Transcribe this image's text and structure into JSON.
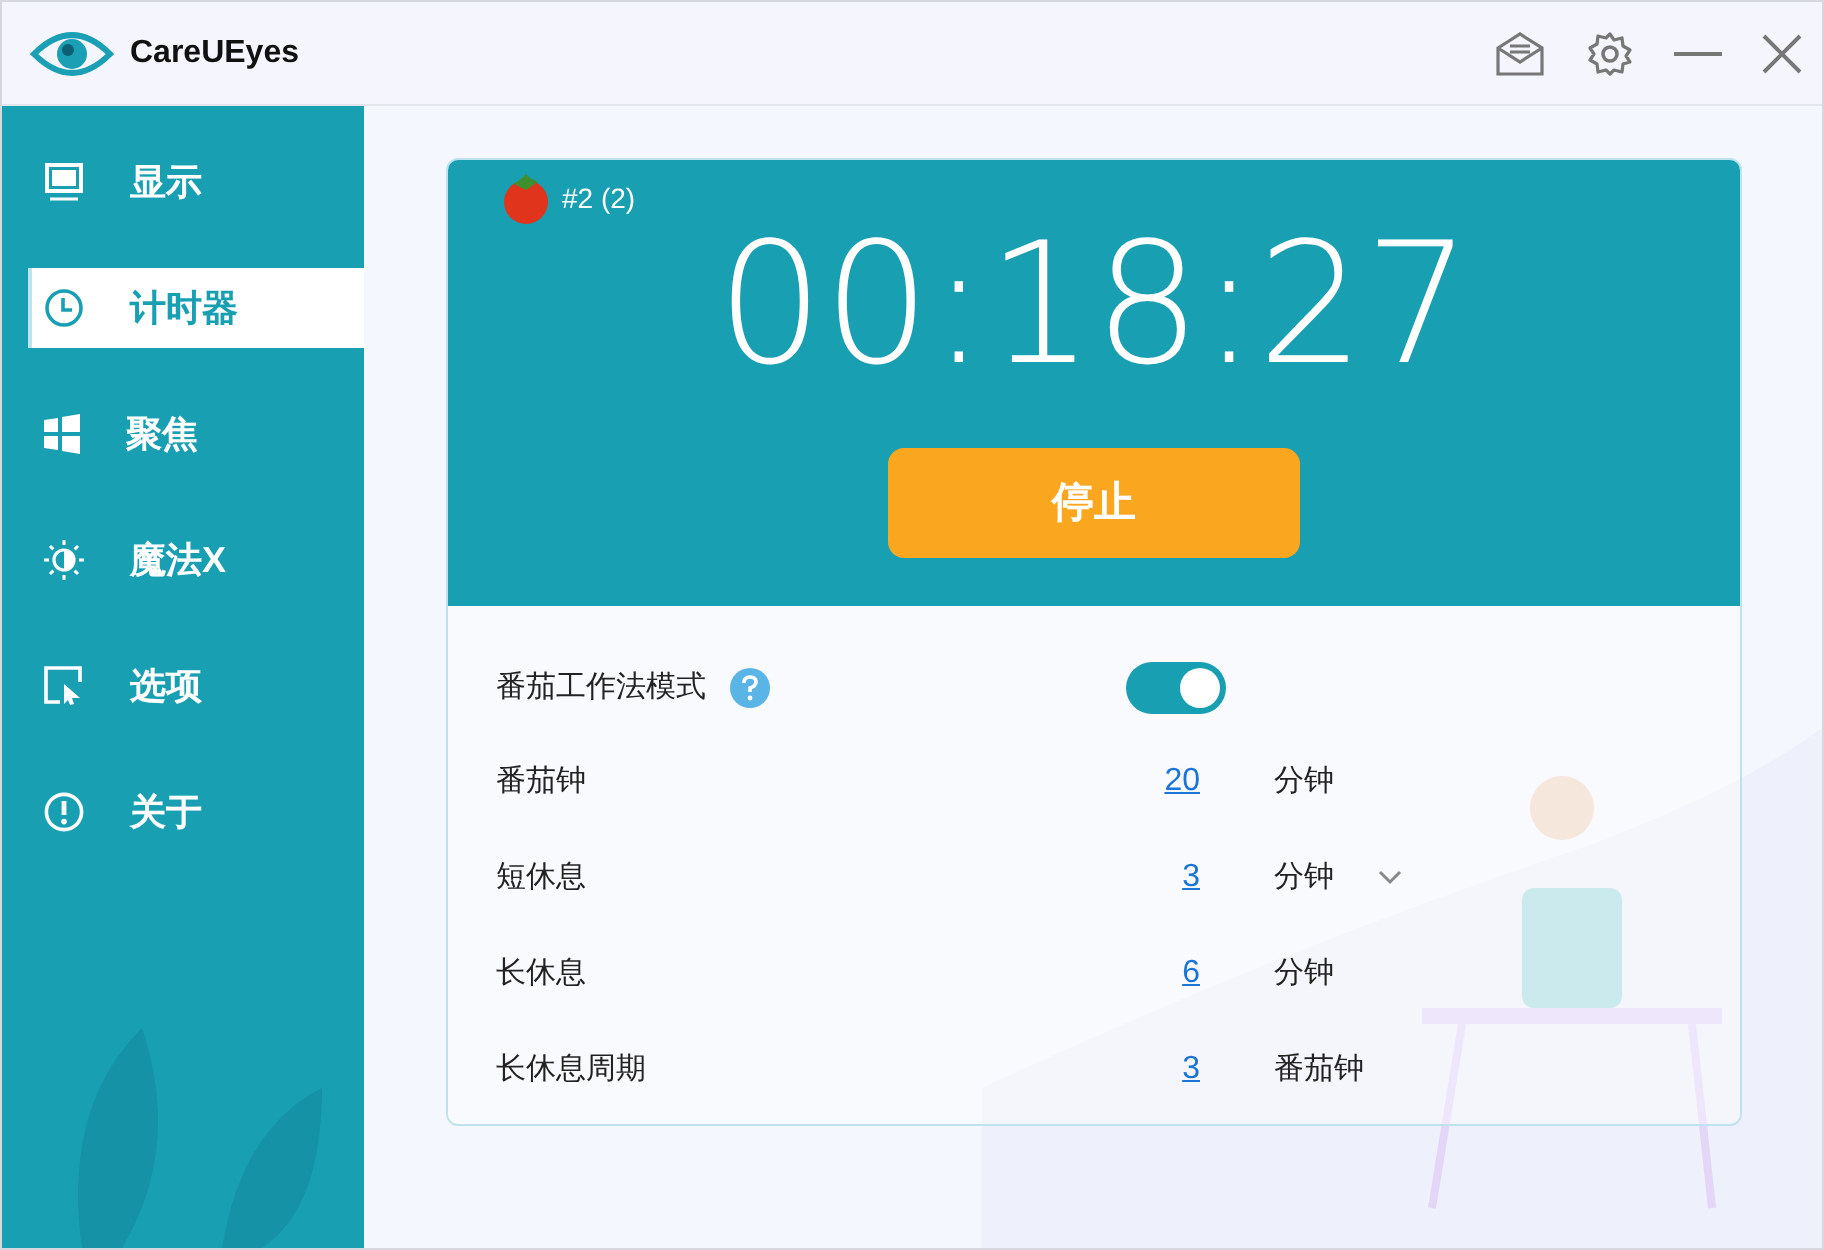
{
  "window": {
    "title": "CareUEyes"
  },
  "sidebar": {
    "items": [
      {
        "label": "显示",
        "selected": false
      },
      {
        "label": "计时器",
        "selected": true
      },
      {
        "label": "聚焦",
        "selected": false
      },
      {
        "label": "魔法X",
        "selected": false
      },
      {
        "label": "选项",
        "selected": false
      },
      {
        "label": "关于",
        "selected": false
      }
    ]
  },
  "timer": {
    "session": "#2 (2)",
    "time": "00:18:27",
    "button": "停止"
  },
  "pomodoro_mode": {
    "label": "番茄工作法模式",
    "on": true
  },
  "settings": [
    {
      "label": "番茄钟",
      "value": "20",
      "unit": "分钟",
      "kind": "plain"
    },
    {
      "label": "短休息",
      "value": "3",
      "unit": "分钟",
      "kind": "dropdown"
    },
    {
      "label": "长休息",
      "value": "6",
      "unit": "分钟",
      "kind": "plain"
    },
    {
      "label": "长休息周期",
      "value": "3",
      "unit": "番茄钟",
      "kind": "plain"
    }
  ]
}
